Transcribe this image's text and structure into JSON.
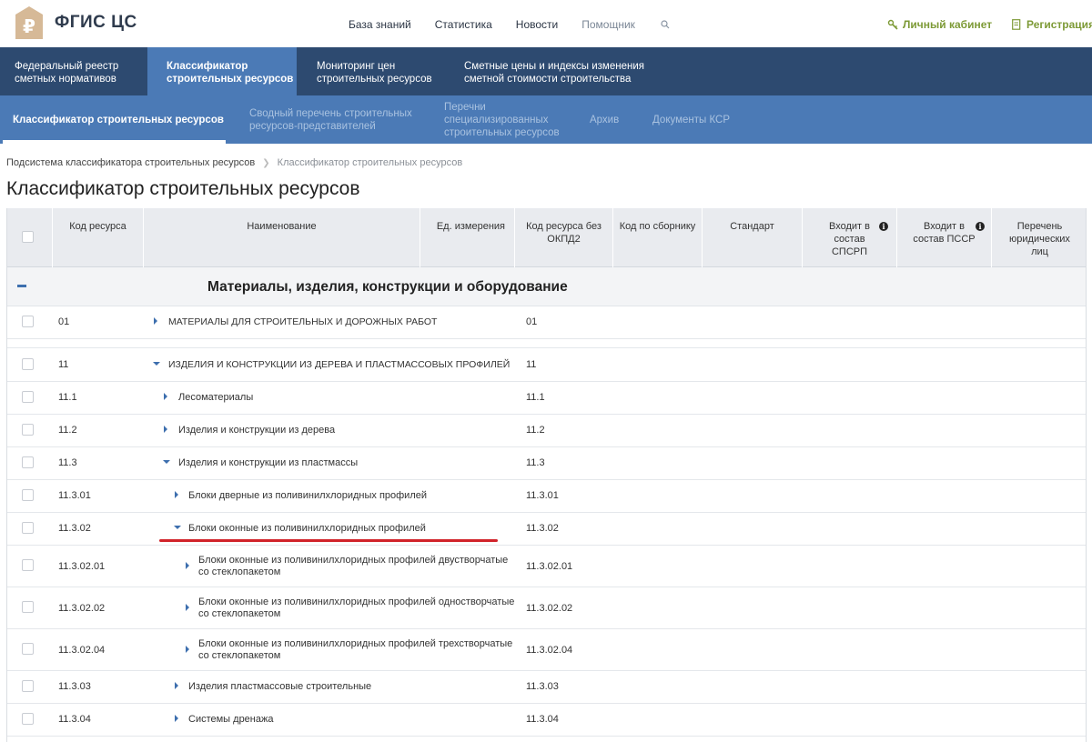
{
  "app": {
    "logo_text": "ФГИС ЦС",
    "logo_color": "#d6b997",
    "brand_navy": "#2d4a70",
    "brand_blue": "#4b7ab6",
    "accent_green": "#7d9a36",
    "highlight_red": "#d1232a"
  },
  "topnav": {
    "items": [
      "База знаний",
      "Статистика",
      "Новости",
      "Помощник"
    ],
    "account_label": "Личный кабинет",
    "register_label": "Регистрация"
  },
  "mainnav": {
    "items": [
      {
        "line1": "Федеральный реестр",
        "line2": "сметных нормативов"
      },
      {
        "line1": "Классификатор",
        "line2": "строительных ресурсов",
        "active": true
      },
      {
        "line1": "Мониторинг цен",
        "line2": "строительных ресурсов"
      },
      {
        "line1": "Сметные цены и индексы изменения",
        "line2": "сметной стоимости строительства"
      }
    ]
  },
  "subnav": {
    "items": [
      {
        "line1": "Классификатор строительных ресурсов",
        "active": true
      },
      {
        "line1": "Сводный перечень строительных",
        "line2": "ресурсов-представителей"
      },
      {
        "line1": "Перечни",
        "line2": "специализированных",
        "line3": "строительных ресурсов"
      },
      {
        "line1": "Архив"
      },
      {
        "line1": "Документы КСР"
      }
    ]
  },
  "breadcrumb": {
    "items": [
      "Подсистема классификатора строительных ресурсов",
      "Классификатор строительных ресурсов"
    ]
  },
  "page": {
    "title": "Классификатор строительных ресурсов"
  },
  "table": {
    "headers": {
      "code": "Код ресурса",
      "name": "Наименование",
      "unit": "Ед. измерения",
      "code_no_okpd": "Код ресурса без ОКПД2",
      "code_collection": "Код по сборнику",
      "standard": "Стандарт",
      "in_spsrp": "Входит в состав СПСРП",
      "in_pssr": "Входит в состав ПССР",
      "legal_entities": "Перечень юридических лиц"
    },
    "group_title": "Материалы, изделия, конструкции и оборудование",
    "rows": [
      {
        "code": "01",
        "name": "МАТЕРИАЛЫ ДЛЯ СТРОИТЕЛЬНЫХ И ДОРОЖНЫХ РАБОТ",
        "code2": "01",
        "expanded": false
      },
      {
        "code": "11",
        "name": "ИЗДЕЛИЯ И КОНСТРУКЦИИ ИЗ ДЕРЕВА И ПЛАСТМАССОВЫХ ПРОФИЛЕЙ",
        "code2": "11",
        "expanded": true
      },
      {
        "code": "11.1",
        "name": "Лесоматериалы",
        "code2": "11.1",
        "expanded": false
      },
      {
        "code": "11.2",
        "name": "Изделия и конструкции из дерева",
        "code2": "11.2",
        "expanded": false
      },
      {
        "code": "11.3",
        "name": "Изделия и конструкции из пластмассы",
        "code2": "11.3",
        "expanded": true
      },
      {
        "code": "11.3.01",
        "name": "Блоки дверные из поливинилхлоридных профилей",
        "code2": "11.3.01",
        "expanded": false
      },
      {
        "code": "11.3.02",
        "name": "Блоки оконные из поливинилхлоридных профилей",
        "code2": "11.3.02",
        "expanded": true
      },
      {
        "code": "11.3.02.01",
        "name_l1": "Блоки оконные из поливинилхлоридных профилей двустворчатые",
        "name_l2": "со стеклопакетом",
        "code2": "11.3.02.01",
        "expanded": false
      },
      {
        "code": "11.3.02.02",
        "name_l1": "Блоки оконные из поливинилхлоридных профилей одностворчатые",
        "name_l2": "со стеклопакетом",
        "code2": "11.3.02.02",
        "expanded": false
      },
      {
        "code": "11.3.02.04",
        "name_l1": "Блоки оконные из поливинилхлоридных профилей трехстворчатые",
        "name_l2": "со стеклопакетом",
        "code2": "11.3.02.04",
        "expanded": false
      },
      {
        "code": "11.3.03",
        "name": "Изделия пластмассовые строительные",
        "code2": "11.3.03",
        "expanded": false
      },
      {
        "code": "11.3.04",
        "name": "Системы дренажа",
        "code2": "11.3.04",
        "expanded": false
      }
    ]
  }
}
